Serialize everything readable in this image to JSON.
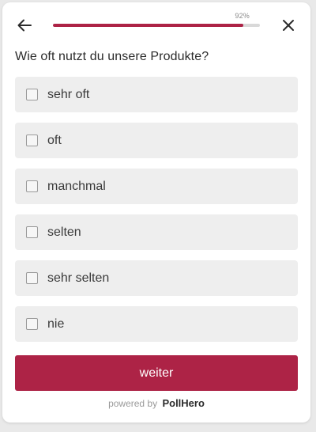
{
  "header": {
    "back_icon": "arrow-left-icon",
    "close_icon": "close-x-icon",
    "progress": {
      "label": "92%",
      "value": 0.92
    }
  },
  "question": {
    "text": "Wie oft nutzt du unsere Produkte?"
  },
  "options": [
    {
      "label": "sehr oft",
      "checked": false
    },
    {
      "label": "oft",
      "checked": false
    },
    {
      "label": "manchmal",
      "checked": false
    },
    {
      "label": "selten",
      "checked": false
    },
    {
      "label": "sehr selten",
      "checked": false
    },
    {
      "label": "nie",
      "checked": false
    }
  ],
  "submit": {
    "label": "weiter"
  },
  "footer": {
    "powered_text": "powered by",
    "brand_part1": "Poll",
    "brand_part2": "Hero"
  },
  "colors": {
    "accent": "#ad2346",
    "option_bg": "#eeeeee",
    "track": "#d9d9d9"
  }
}
